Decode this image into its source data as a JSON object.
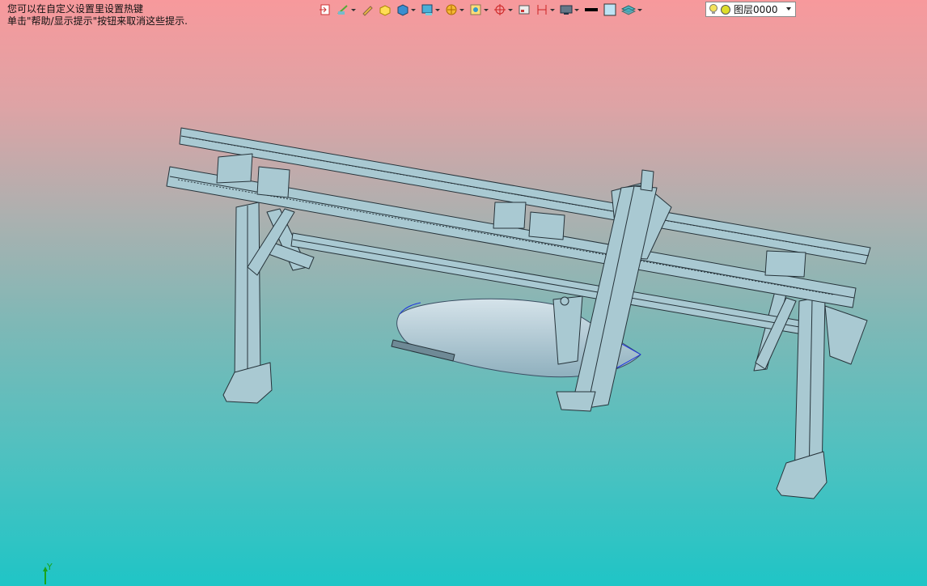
{
  "hint": {
    "line1": "您可以在自定义设置里设置热键",
    "line2": "单击\"帮助/显示提示\"按钮来取消这些提示."
  },
  "toolbar": {
    "icons": [
      "exit-sketch-icon",
      "sketch-icon",
      "pencil-icon",
      "box-icon",
      "solid-icon",
      "display-icon",
      "render-icon",
      "view-icon",
      "snap-icon",
      "rectangle-icon",
      "dimension-icon",
      "monitor-icon",
      "line-color-icon",
      "fill-color-icon",
      "layer-stack-icon"
    ]
  },
  "layer": {
    "selected": "图层0000",
    "colors": {
      "bulb": "#f4e25b",
      "circle": "#dede2a"
    }
  },
  "viewport": {
    "background_top": "#f7999c",
    "background_bottom": "#1fc5c6",
    "model_color": "#a9c9d2",
    "edge_color": "#26333a"
  },
  "triad": {
    "y_label": "Y"
  }
}
